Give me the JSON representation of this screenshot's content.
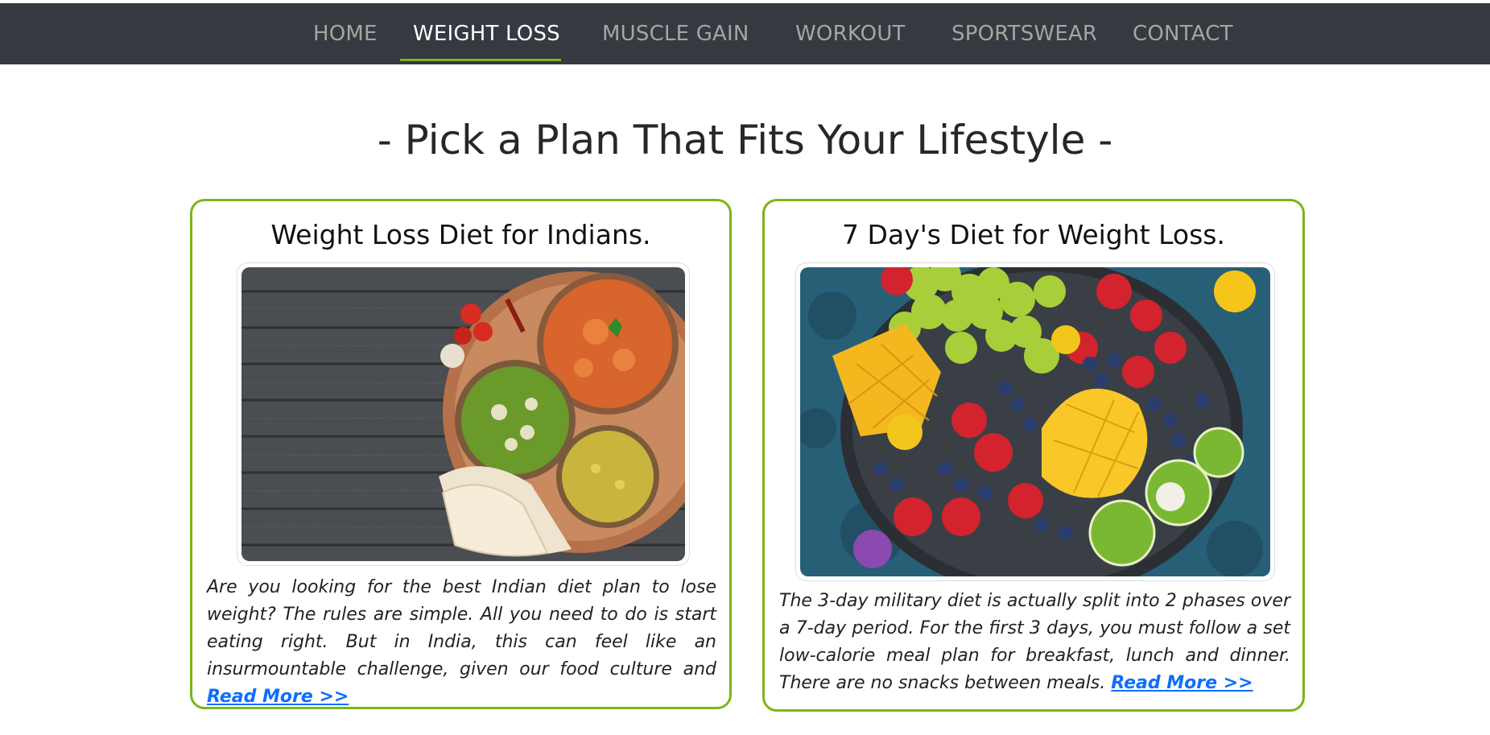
{
  "nav": {
    "items": [
      {
        "label": "HOME"
      },
      {
        "label": "WEIGHT LOSS"
      },
      {
        "label": "MUSCLE GAIN"
      },
      {
        "label": "WORKOUT"
      },
      {
        "label": "SPORTSWEAR"
      },
      {
        "label": "CONTACT"
      }
    ],
    "active": "WEIGHT LOSS"
  },
  "main": {
    "heading": "- Pick a Plan That Fits Your Lifestyle -"
  },
  "cards": [
    {
      "title": "Weight Loss Diet for Indians.",
      "text": "Are you looking for the best Indian diet plan to lose weight? The rules are simple. All you need to do is start eating right. But in India, this can feel like an insurmountable challenge, given our food culture and ",
      "link": "Read More >>"
    },
    {
      "title": "7 Day's Diet for Weight Loss.",
      "text": "The 3-day military diet is actually split into 2 phases over a 7-day period. For the first 3 days, you must follow a set low-calorie meal plan for breakfast, lunch and dinner. There are no snacks between meals. ",
      "link": "Read More >>"
    }
  ],
  "colors": {
    "navbar": "#343a40",
    "accent": "#7cb518",
    "link": "#0d6efd",
    "nav_inactive": "#a3a7a1"
  }
}
